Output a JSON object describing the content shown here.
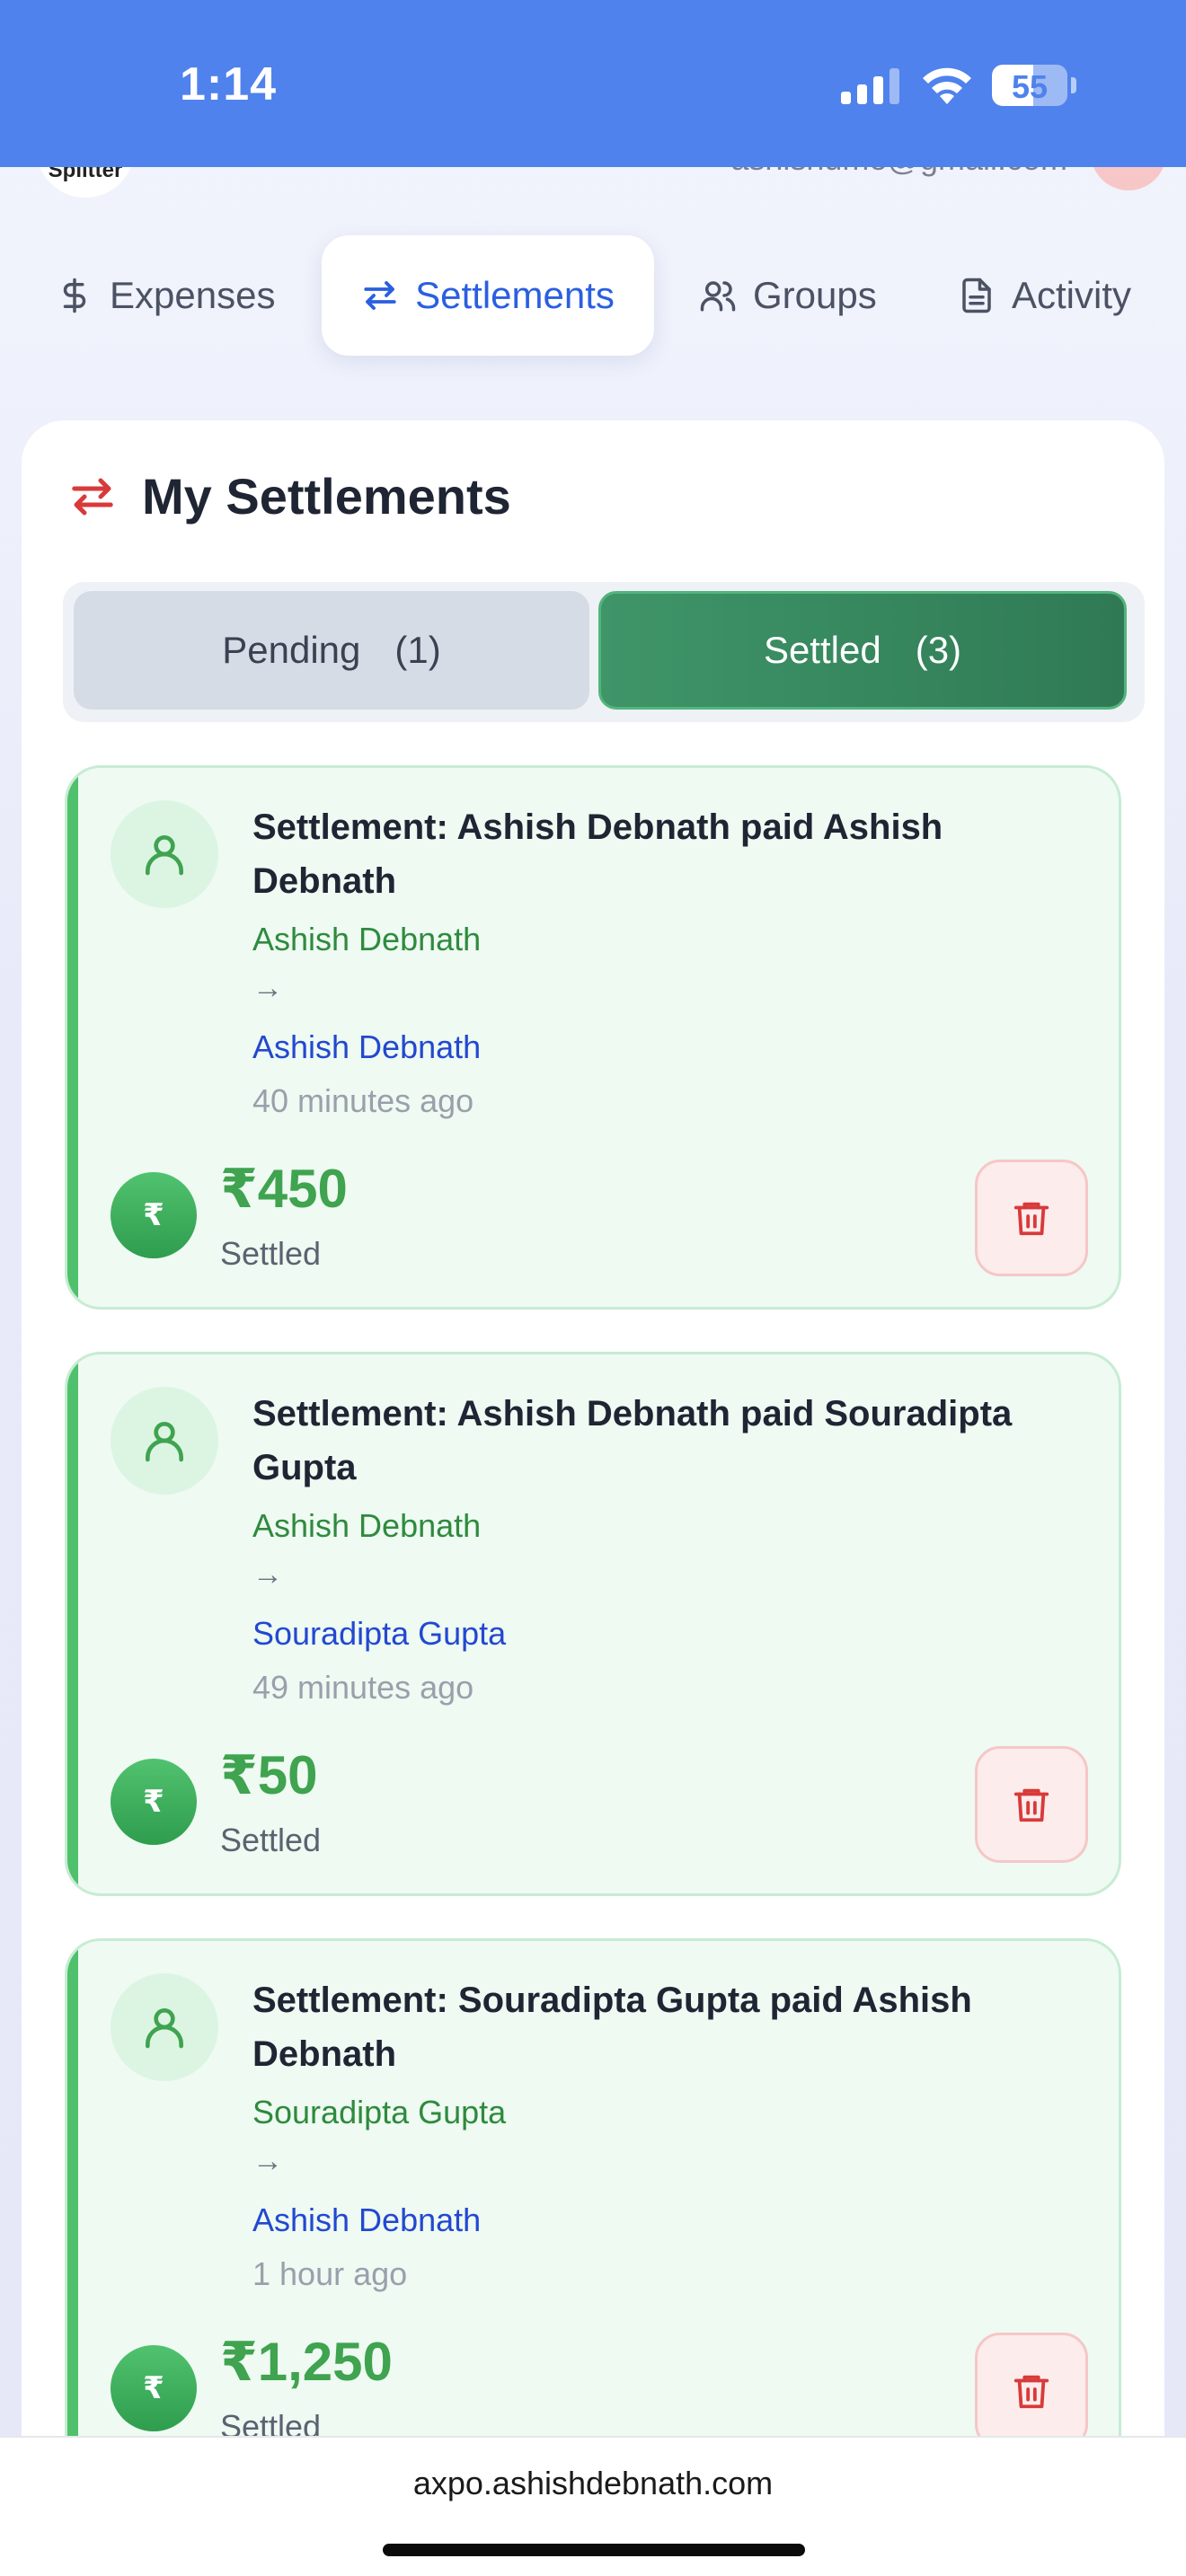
{
  "status_bar": {
    "time": "1:14",
    "battery": "55",
    "battery_level": 0.55
  },
  "header": {
    "logo_text": "Splitter",
    "email": "ashishume@gmail.com"
  },
  "tabs": [
    {
      "label": "Expenses",
      "icon": "dollar-icon",
      "active": false
    },
    {
      "label": "Settlements",
      "icon": "swap-arrows-icon",
      "active": true
    },
    {
      "label": "Groups",
      "icon": "users-icon",
      "active": false
    },
    {
      "label": "Activity",
      "icon": "document-icon",
      "active": false
    }
  ],
  "section": {
    "title": "My Settlements",
    "icon": "swap-arrows-icon"
  },
  "filter": {
    "pending_label": "Pending",
    "pending_count": "(1)",
    "settled_label": "Settled",
    "settled_count": "(3)",
    "selected": "Settled"
  },
  "settlements": [
    {
      "title": "Settlement: Ashish Debnath paid Ashish Debnath",
      "from": "Ashish Debnath",
      "arrow": "→",
      "to": "Ashish Debnath",
      "time": "40 minutes ago",
      "amount": "₹450",
      "status": "Settled",
      "currency": "₹"
    },
    {
      "title": "Settlement: Ashish Debnath paid Souradipta Gupta",
      "from": "Ashish Debnath",
      "arrow": "→",
      "to": "Souradipta Gupta",
      "time": "49 minutes ago",
      "amount": "₹50",
      "status": "Settled",
      "currency": "₹"
    },
    {
      "title": "Settlement: Souradipta Gupta paid Ashish Debnath",
      "from": "Souradipta Gupta",
      "arrow": "→",
      "to": "Ashish Debnath",
      "time": "1 hour ago",
      "amount": "₹1,250",
      "status": "Settled",
      "currency": "₹"
    }
  ],
  "browser": {
    "url": "axpo.ashishdebnath.com"
  },
  "colors": {
    "accent": "#2a5fe0",
    "status_bar": "#4f82ec",
    "settled_green": "#3f9568",
    "amount_green": "#3fa34f",
    "delete_red": "#d83a3a"
  }
}
